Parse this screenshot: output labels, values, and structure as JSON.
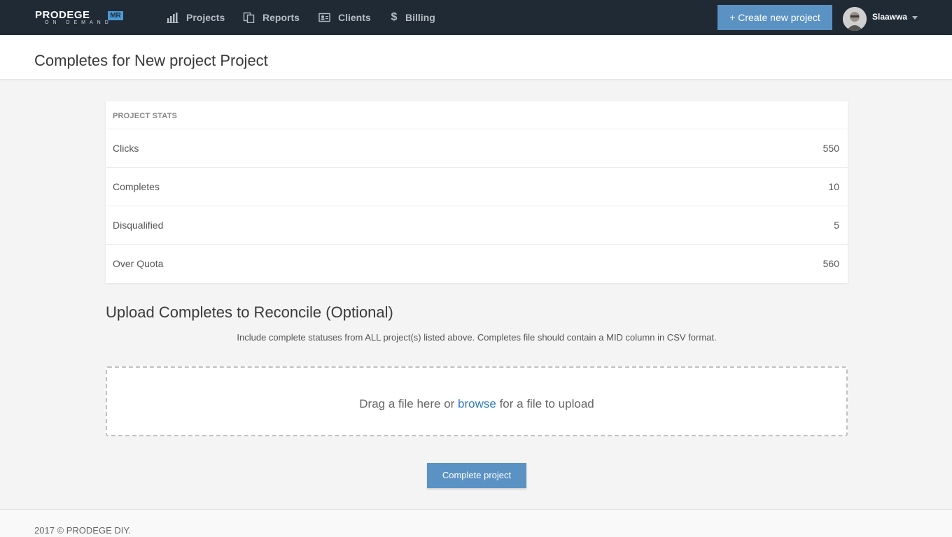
{
  "app": {
    "logo_text": "PRODEGE",
    "logo_badge": "MR",
    "logo_sub": "ON DEMAND"
  },
  "nav": {
    "items": [
      {
        "label": "Projects",
        "icon": "bar-chart-icon"
      },
      {
        "label": "Reports",
        "icon": "documents-icon"
      },
      {
        "label": "Clients",
        "icon": "id-card-icon"
      },
      {
        "label": "Billing",
        "icon": "dollar-icon"
      }
    ],
    "create_label": "+ Create new project",
    "username": "Slaawwa"
  },
  "page": {
    "title": "Completes for New project Project"
  },
  "stats": {
    "header": "PROJECT STATS",
    "rows": [
      {
        "label": "Clicks",
        "value": "550"
      },
      {
        "label": "Completes",
        "value": "10"
      },
      {
        "label": "Disqualified",
        "value": "5"
      },
      {
        "label": "Over Quota",
        "value": "560"
      }
    ]
  },
  "upload": {
    "title": "Upload Completes to Reconcile (Optional)",
    "description": "Include complete statuses from ALL project(s) listed above. Completes file should contain a MID column in CSV format.",
    "drop_prefix": "Drag a file here or ",
    "drop_link": "browse",
    "drop_suffix": " for a file to upload"
  },
  "actions": {
    "complete_label": "Complete project"
  },
  "footer": {
    "text": "2017 © PRODEGE DIY."
  },
  "colors": {
    "navbar": "#1f2a35",
    "primary_button": "#5b92c4",
    "link": "#2e7cbf",
    "background": "#f4f4f4"
  }
}
